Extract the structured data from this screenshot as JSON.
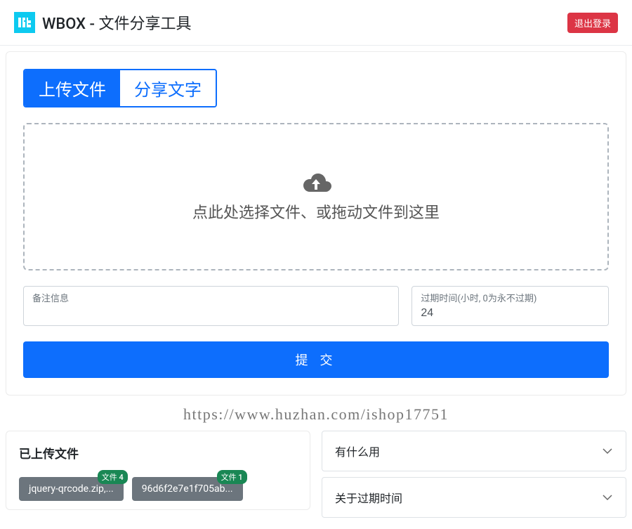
{
  "header": {
    "title": "WBOX - 文件分享工具",
    "logout_label": "退出登录"
  },
  "tabs": {
    "upload_label": "上传文件",
    "share_text_label": "分享文字"
  },
  "dropzone": {
    "text": "点此处选择文件、或拖动文件到这里"
  },
  "form": {
    "remark_label": "备注信息",
    "remark_value": "",
    "expire_label": "过期时间(小时, 0为永不过期)",
    "expire_value": "24",
    "submit_label": "提 交"
  },
  "watermark": "https://www.huzhan.com/ishop17751",
  "uploaded": {
    "title": "已上传文件",
    "files": [
      {
        "name": "jquery-qrcode.zip,...",
        "badge": "文件 4"
      },
      {
        "name": "96d6f2e7e1f705ab...",
        "badge": "文件 1"
      }
    ],
    "extra_badge": "文件 1"
  },
  "faq": {
    "items": [
      {
        "label": "有什么用"
      },
      {
        "label": "关于过期时间"
      }
    ]
  }
}
